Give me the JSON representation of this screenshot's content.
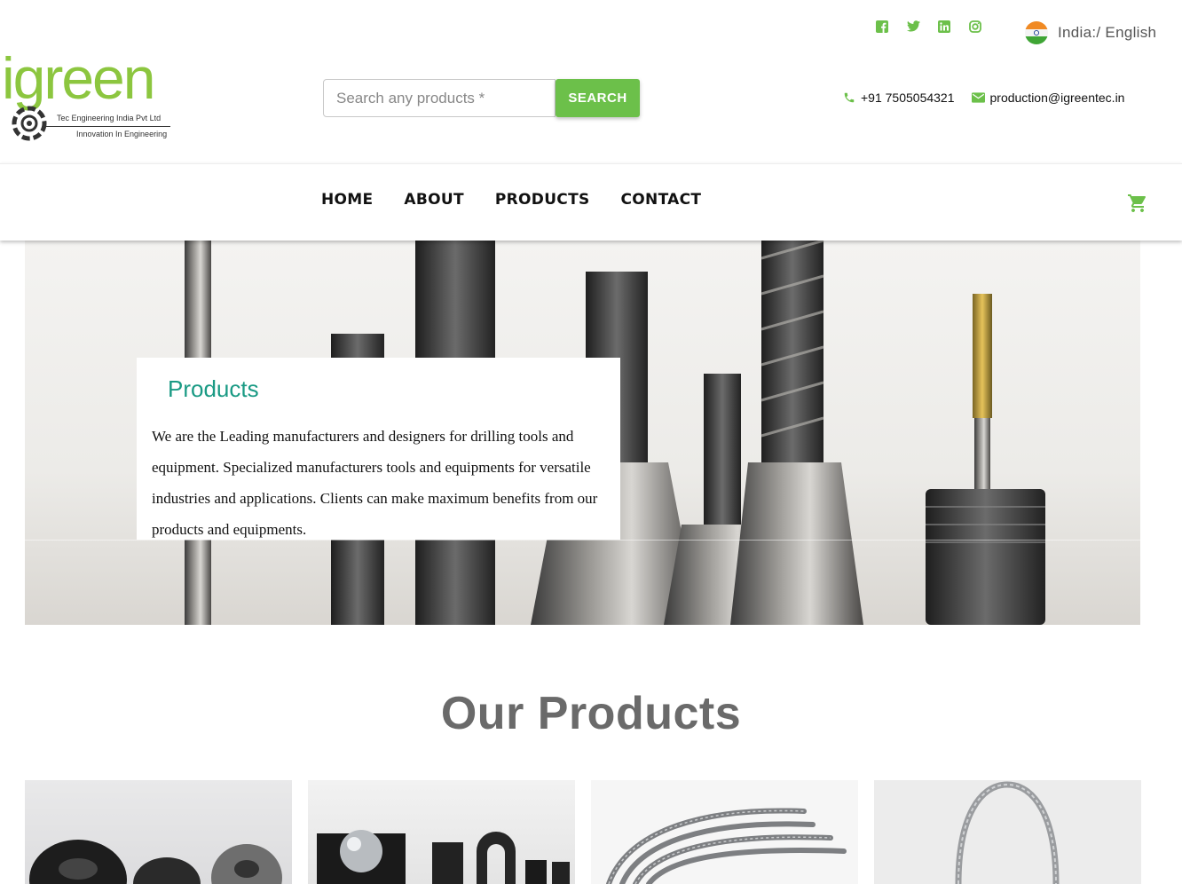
{
  "brand": {
    "logo_word": "igreen",
    "logo_line1": "Tec Engineering India Pvt Ltd",
    "logo_line2": "Innovation In Engineering",
    "accent_color": "#8cc63f",
    "button_color": "#6cc04a",
    "heading_color": "#1a9a84"
  },
  "search": {
    "placeholder": "Search any products *",
    "button_label": "SEARCH"
  },
  "social": [
    "facebook-icon",
    "twitter-icon",
    "linkedin-icon",
    "instagram-icon"
  ],
  "language": {
    "label": "India:/ English",
    "flag": "india-flag-icon"
  },
  "contact": {
    "phone": "+91 7505054321",
    "email": "production@igreentec.in"
  },
  "nav": {
    "items": [
      "HOME",
      "ABOUT",
      "PRODUCTS",
      "CONTACT"
    ]
  },
  "hero": {
    "title": "Products",
    "description": "We are the Leading manufacturers and designers for drilling tools and equipment. Specialized manufacturers tools and equipments for versatile industries and applications. Clients can make maximum benefits from our products and equipments."
  },
  "products_section": {
    "title": "Our Products",
    "cards": [
      "product-image-rubber-parts",
      "product-image-ball-holders",
      "product-image-cable-grips",
      "product-image-cable-sock"
    ]
  }
}
